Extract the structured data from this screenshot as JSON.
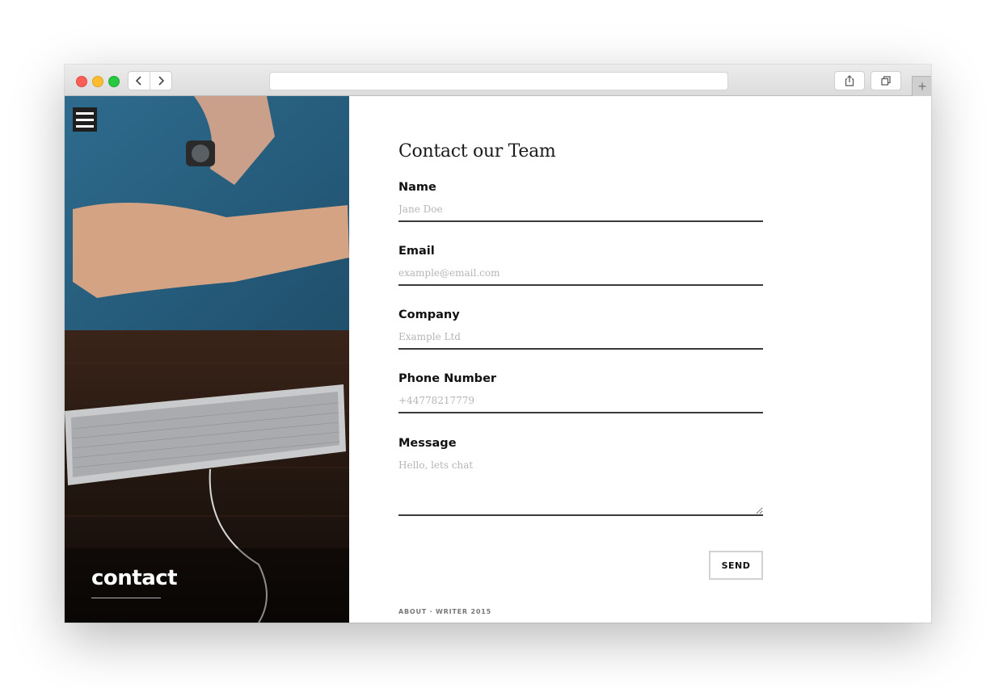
{
  "browser": {
    "back_icon": "chevron-left-icon",
    "forward_icon": "chevron-right-icon",
    "address": "",
    "new_tab_label": "+"
  },
  "hero": {
    "title": "contact",
    "menu_icon": "hamburger-menu-icon"
  },
  "form": {
    "title": "Contact our Team",
    "fields": [
      {
        "label": "Name",
        "placeholder": "Jane Doe"
      },
      {
        "label": "Email",
        "placeholder": "example@email.com"
      },
      {
        "label": "Company",
        "placeholder": "Example Ltd"
      },
      {
        "label": "Phone Number",
        "placeholder": "+44778217779"
      }
    ],
    "message": {
      "label": "Message",
      "placeholder": "Hello, lets chat"
    },
    "send_label": "SEND"
  },
  "footer": {
    "text": "ABOUT · WRITER 2015"
  }
}
